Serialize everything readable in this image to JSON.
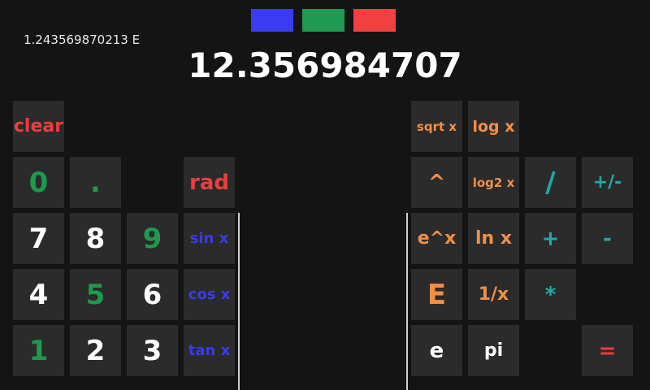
{
  "theme_swatches": [
    {
      "name": "blue",
      "color": "#3b3bf0"
    },
    {
      "name": "green",
      "color": "#1f9a52"
    },
    {
      "name": "red",
      "color": "#f04040"
    }
  ],
  "display": {
    "secondary": "1.243569870213 E",
    "primary": "12.356984707"
  },
  "keys": {
    "clear": "clear",
    "zero": "0",
    "dot": ".",
    "rad": "rad",
    "seven": "7",
    "eight": "8",
    "nine": "9",
    "sin": "sin x",
    "four": "4",
    "five": "5",
    "six": "6",
    "cos": "cos x",
    "one": "1",
    "two": "2",
    "three": "3",
    "tan": "tan x",
    "sqrt": "sqrt x",
    "log": "log x",
    "power": "^",
    "log2": "log2 x",
    "divide": "/",
    "negate": "+/-",
    "exp": "e^x",
    "ln": "ln x",
    "plus": "+",
    "minus": "-",
    "sci_e": "E",
    "reciprocal": "1/x",
    "multiply": "*",
    "euler": "e",
    "pi": "pi",
    "equals": "="
  }
}
